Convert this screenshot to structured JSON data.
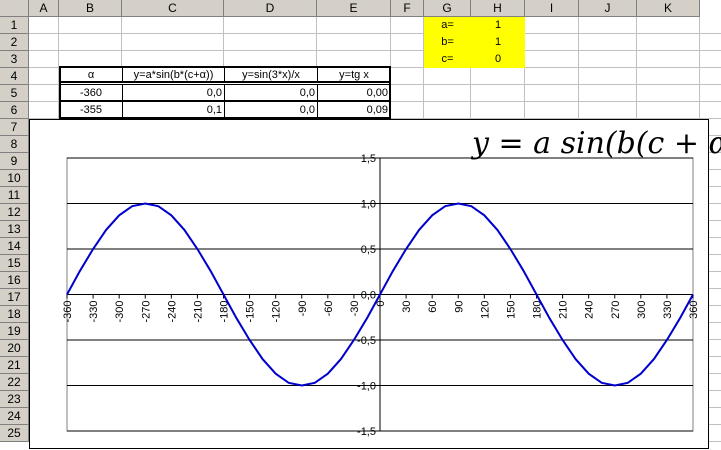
{
  "sheet": {
    "columns": [
      "A",
      "B",
      "C",
      "D",
      "E",
      "F",
      "G",
      "H",
      "I",
      "J",
      "K"
    ],
    "rows": [
      "1",
      "2",
      "3",
      "4",
      "5",
      "6",
      "7",
      "8",
      "9",
      "10",
      "11",
      "12",
      "13",
      "14",
      "15",
      "16",
      "17",
      "18",
      "19",
      "20",
      "21",
      "22",
      "23",
      "24",
      "25"
    ]
  },
  "params": {
    "a_label": "a=",
    "a_value": "1",
    "b_label": "b=",
    "b_value": "1",
    "c_label": "c=",
    "c_value": "0",
    "fill_color": "#ffff00"
  },
  "table": {
    "headers": [
      "α",
      "y=a*sin(b*(c+α))",
      "y=sin(3*x)/x",
      "y=tg x"
    ],
    "rows": [
      [
        "-360",
        "0,0",
        "0,0",
        "0,00"
      ],
      [
        "-355",
        "0,1",
        "0,0",
        "0,09"
      ]
    ]
  },
  "chart_data": {
    "type": "line",
    "title": "y = a sin(b(c + α))",
    "series_color": "#0000cc",
    "grid": true,
    "xlim": [
      -360,
      360
    ],
    "ylim": [
      -1.5,
      1.5
    ],
    "x_ticks": [
      "-360",
      "-330",
      "-300",
      "-270",
      "-240",
      "-210",
      "-180",
      "-150",
      "-120",
      "-90",
      "-60",
      "-30",
      "0",
      "30",
      "60",
      "90",
      "120",
      "150",
      "180",
      "210",
      "240",
      "270",
      "300",
      "330",
      "360"
    ],
    "y_ticks": [
      "1,5",
      "1,0",
      "0,5",
      "0,0",
      "-0,5",
      "-1,0",
      "-1,5"
    ],
    "series": [
      {
        "x": [
          -360,
          -345,
          -330,
          -315,
          -300,
          -285,
          -270,
          -255,
          -240,
          -225,
          -210,
          -195,
          -180,
          -165,
          -150,
          -135,
          -120,
          -105,
          -90,
          -75,
          -60,
          -45,
          -30,
          -15,
          0,
          15,
          30,
          45,
          60,
          75,
          90,
          105,
          120,
          135,
          150,
          165,
          180,
          195,
          210,
          225,
          240,
          255,
          270,
          285,
          300,
          315,
          330,
          345,
          360
        ],
        "y": [
          0,
          0.26,
          0.5,
          0.71,
          0.87,
          0.97,
          1,
          0.97,
          0.87,
          0.71,
          0.5,
          0.26,
          0,
          -0.26,
          -0.5,
          -0.71,
          -0.87,
          -0.97,
          -1,
          -0.97,
          -0.87,
          -0.71,
          -0.5,
          -0.26,
          0,
          0.26,
          0.5,
          0.71,
          0.87,
          0.97,
          1,
          0.97,
          0.87,
          0.71,
          0.5,
          0.26,
          0,
          -0.26,
          -0.5,
          -0.71,
          -0.87,
          -0.97,
          -1,
          -0.97,
          -0.87,
          -0.71,
          -0.5,
          -0.26,
          0
        ]
      }
    ]
  }
}
